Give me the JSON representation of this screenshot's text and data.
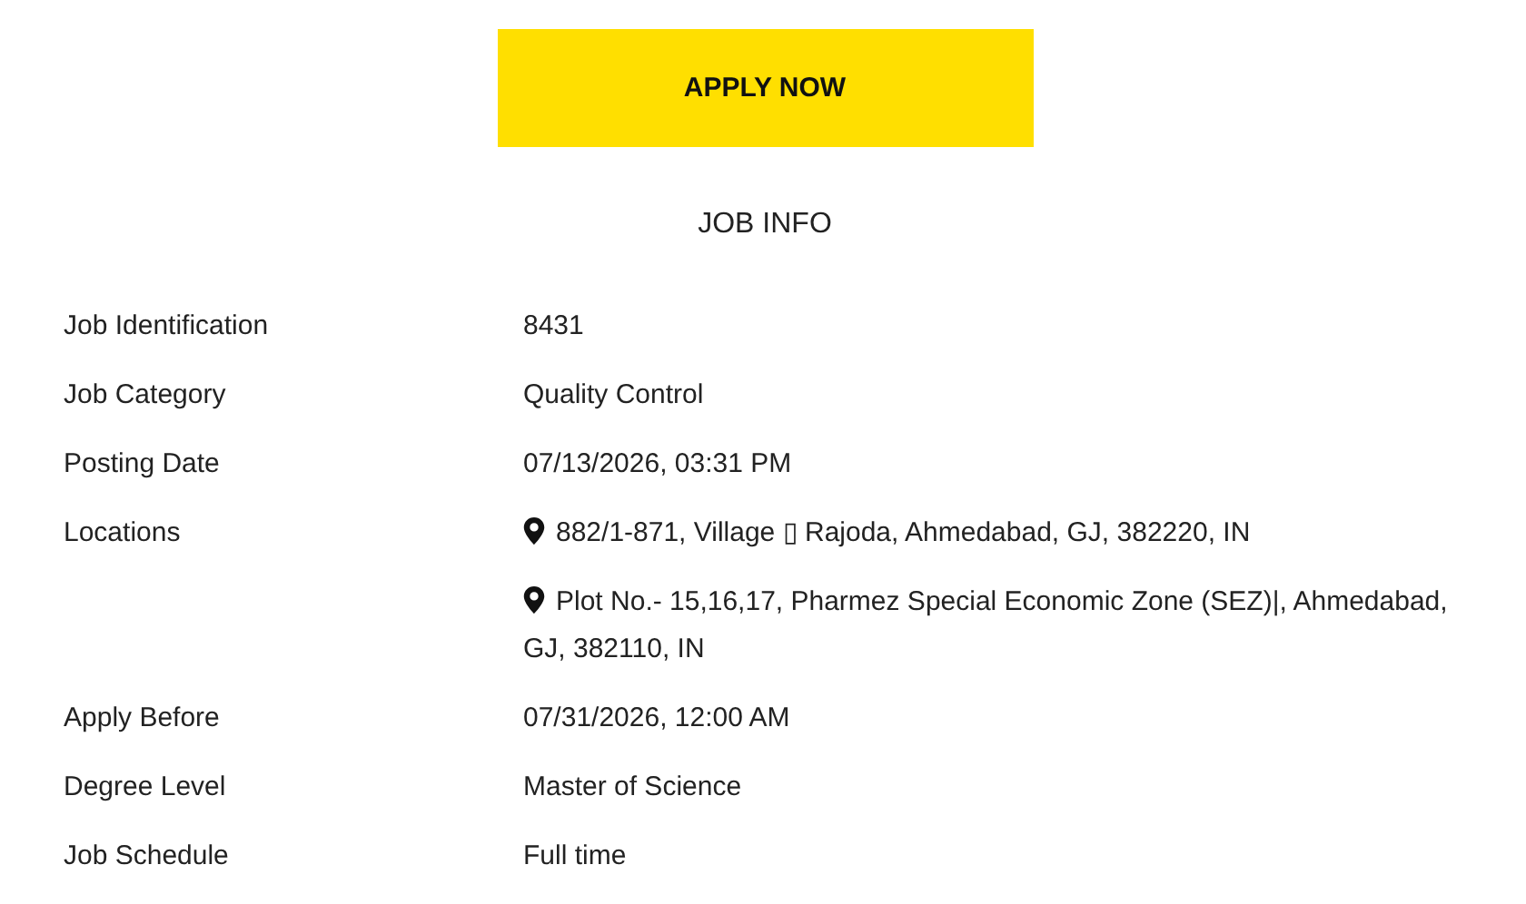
{
  "apply_button": "APPLY NOW",
  "section_title": "JOB INFO",
  "rows": [
    {
      "label": "Job Identification",
      "values": [
        "8431"
      ]
    },
    {
      "label": "Job Category",
      "values": [
        "Quality Control"
      ]
    },
    {
      "label": "Posting Date",
      "values": [
        "07/13/2026, 03:31 PM"
      ]
    },
    {
      "label": "Locations",
      "kind": "locations",
      "values": [
        "882/1-871, Village ▯ Rajoda, Ahmedabad, GJ, 382220, IN",
        "Plot No.- 15,16,17, Pharmez Special Economic Zone (SEZ)|, Ahmedabad, GJ, 382110, IN"
      ]
    },
    {
      "label": "Apply Before",
      "values": [
        "07/31/2026, 12:00 AM"
      ]
    },
    {
      "label": "Degree Level",
      "values": [
        "Master of Science"
      ]
    },
    {
      "label": "Job Schedule",
      "values": [
        "Full time"
      ]
    }
  ]
}
